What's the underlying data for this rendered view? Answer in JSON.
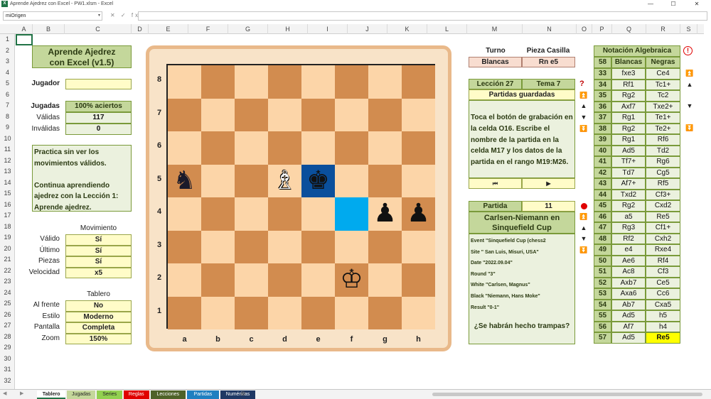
{
  "window": {
    "title": "Aprende Ajedrez con Excel - PW1.xlsm - Excel",
    "min": "—",
    "max": "☐",
    "close": "✕"
  },
  "formula_bar": {
    "name_box": "miOrigen",
    "fx_label": "✕ ✓ fx",
    "value": ""
  },
  "columns": [
    "A",
    "B",
    "C",
    "D",
    "E",
    "F",
    "G",
    "H",
    "I",
    "J",
    "K",
    "L",
    "M",
    "N",
    "O",
    "P",
    "Q",
    "R",
    "S"
  ],
  "rows": [
    "1",
    "2",
    "3",
    "4",
    "5",
    "6",
    "7",
    "8",
    "9",
    "10",
    "11",
    "12",
    "13",
    "14",
    "15",
    "16",
    "17",
    "18",
    "19",
    "20",
    "21",
    "22",
    "23",
    "24",
    "25",
    "26",
    "27",
    "28",
    "29",
    "30",
    "31",
    "32"
  ],
  "left": {
    "title_line1": "Aprende Ajedrez",
    "title_line2": "con Excel (v1.5)",
    "jugador_label": "Jugador",
    "jugador_value": "",
    "jugadas_label": "Jugadas",
    "jugadas_value": "100% aciertos",
    "validas_label": "Válidas",
    "validas_value": "117",
    "invalidas_label": "Inválidas",
    "invalidas_value": "0",
    "message": [
      "Practica sin ver los",
      "movimientos válidos.",
      "",
      "Continua aprendiendo",
      "ajedrez con la Lección 1:",
      "Aprende ajedrez."
    ],
    "movimiento_header": "Movimiento",
    "movimiento": [
      {
        "label": "Válido",
        "value": "Sí"
      },
      {
        "label": "Último",
        "value": "Sí"
      },
      {
        "label": "Piezas",
        "value": "Sí"
      },
      {
        "label": "Velocidad",
        "value": "x5"
      }
    ],
    "tablero_header": "Tablero",
    "tablero": [
      {
        "label": "Al frente",
        "value": "No"
      },
      {
        "label": "Estilo",
        "value": "Moderno"
      },
      {
        "label": "Pantalla",
        "value": "Completa"
      },
      {
        "label": "Zoom",
        "value": "150%"
      }
    ]
  },
  "board": {
    "ranks": [
      "8",
      "7",
      "6",
      "5",
      "4",
      "3",
      "2",
      "1"
    ],
    "files": [
      "a",
      "b",
      "c",
      "d",
      "e",
      "f",
      "g",
      "h"
    ],
    "light": "#fcd5a8",
    "dark": "#d28c4f",
    "highlight_blue": "#00aaee",
    "highlight_dark": "#0a4f9c",
    "pieces": [
      {
        "square": "a5",
        "glyph": "♞",
        "color": "#1a1a2a",
        "name": "black-knight-icon"
      },
      {
        "square": "d5",
        "glyph": "♗",
        "color": "#fff",
        "name": "white-bishop-icon"
      },
      {
        "square": "e5",
        "glyph": "♚",
        "color": "#111",
        "name": "black-king-icon"
      },
      {
        "square": "g4",
        "glyph": "♟",
        "color": "#111",
        "name": "black-pawn-icon"
      },
      {
        "square": "h4",
        "glyph": "♟",
        "color": "#111",
        "name": "black-pawn-icon"
      },
      {
        "square": "f2",
        "glyph": "♔",
        "color": "#111",
        "name": "white-king-icon"
      }
    ],
    "highlights": [
      {
        "square": "e5",
        "color": "#0a4f9c"
      },
      {
        "square": "f4",
        "color": "#00aaee"
      }
    ]
  },
  "middle": {
    "turno_label": "Turno",
    "pieza_label": "Pieza Casilla",
    "turno_value": "Blancas",
    "pieza_value": "Rn e5",
    "leccion": "Lección 27",
    "tema": "Tema 7",
    "partidas_guardadas": "Partidas guardadas",
    "instructions": "Toca el botón de grabación en la celda O16. Escribe el nombre de la partida en la celda M17 y los datos de la partida en el rango M19:M26.",
    "nav_prev": "⏮",
    "nav_next": "▶",
    "partida_label": "Partida",
    "partida_value": "11",
    "game_title_line1": "Carlsen-Niemann en",
    "game_title_line2": "Sinquefield Cup",
    "pgn": [
      "Event \"Sinquefield Cup (chess2",
      "Site \" San Luis, Misuri, USA\"",
      "Date \"2022.09.04\"",
      "Round \"3\"",
      "White \"Carlsen, Magnus\"",
      "Black \"Niemann, Hans Moke\"",
      "Result \"0-1\""
    ],
    "question": "¿Se habrán hecho trampas?"
  },
  "notation": {
    "header": "Notación Algebraica",
    "num_header": "58",
    "blancas_header": "Blancas",
    "negras_header": "Negras",
    "moves": [
      {
        "n": "33",
        "w": "fxe3",
        "b": "Ce4"
      },
      {
        "n": "34",
        "w": "Rf1",
        "b": "Tc1+"
      },
      {
        "n": "35",
        "w": "Rg2",
        "b": "Tc2"
      },
      {
        "n": "36",
        "w": "Axf7",
        "b": "Txe2+"
      },
      {
        "n": "37",
        "w": "Rg1",
        "b": "Te1+"
      },
      {
        "n": "38",
        "w": "Rg2",
        "b": "Te2+"
      },
      {
        "n": "39",
        "w": "Rg1",
        "b": "Rf6"
      },
      {
        "n": "40",
        "w": "Ad5",
        "b": "Td2"
      },
      {
        "n": "41",
        "w": "Tf7+",
        "b": "Rg6"
      },
      {
        "n": "42",
        "w": "Td7",
        "b": "Cg5"
      },
      {
        "n": "43",
        "w": "Af7+",
        "b": "Rf5"
      },
      {
        "n": "44",
        "w": "Txd2",
        "b": "Cf3+"
      },
      {
        "n": "45",
        "w": "Rg2",
        "b": "Cxd2"
      },
      {
        "n": "46",
        "w": "a5",
        "b": "Re5"
      },
      {
        "n": "47",
        "w": "Rg3",
        "b": "Cf1+"
      },
      {
        "n": "48",
        "w": "Rf2",
        "b": "Cxh2"
      },
      {
        "n": "49",
        "w": "e4",
        "b": "Rxe4"
      },
      {
        "n": "50",
        "w": "Ae6",
        "b": "Rf4"
      },
      {
        "n": "51",
        "w": "Ac8",
        "b": "Cf3"
      },
      {
        "n": "52",
        "w": "Axb7",
        "b": "Ce5"
      },
      {
        "n": "53",
        "w": "Axa6",
        "b": "Cc6"
      },
      {
        "n": "54",
        "w": "Ab7",
        "b": "Cxa5"
      },
      {
        "n": "55",
        "w": "Ad5",
        "b": "h5"
      },
      {
        "n": "56",
        "w": "Af7",
        "b": "h4"
      },
      {
        "n": "57",
        "w": "Ad5",
        "b": "Re5"
      }
    ],
    "info_icon": "ⓘ"
  },
  "sheet_tabs": [
    {
      "label": "Tablero",
      "color": "#ffffff",
      "text": "#222",
      "active": true
    },
    {
      "label": "Jugadas",
      "color": "#c4d79b",
      "text": "#222"
    },
    {
      "label": "Series",
      "color": "#92d050",
      "text": "#222"
    },
    {
      "label": "Reglas",
      "color": "#e00000",
      "text": "#fff"
    },
    {
      "label": "Lecciones",
      "color": "#4f6228",
      "text": "#fff"
    },
    {
      "label": "Partidas",
      "color": "#1f7fc0",
      "text": "#fff"
    },
    {
      "label": "Numéricas",
      "color": "#1f3864",
      "text": "#fff"
    }
  ]
}
